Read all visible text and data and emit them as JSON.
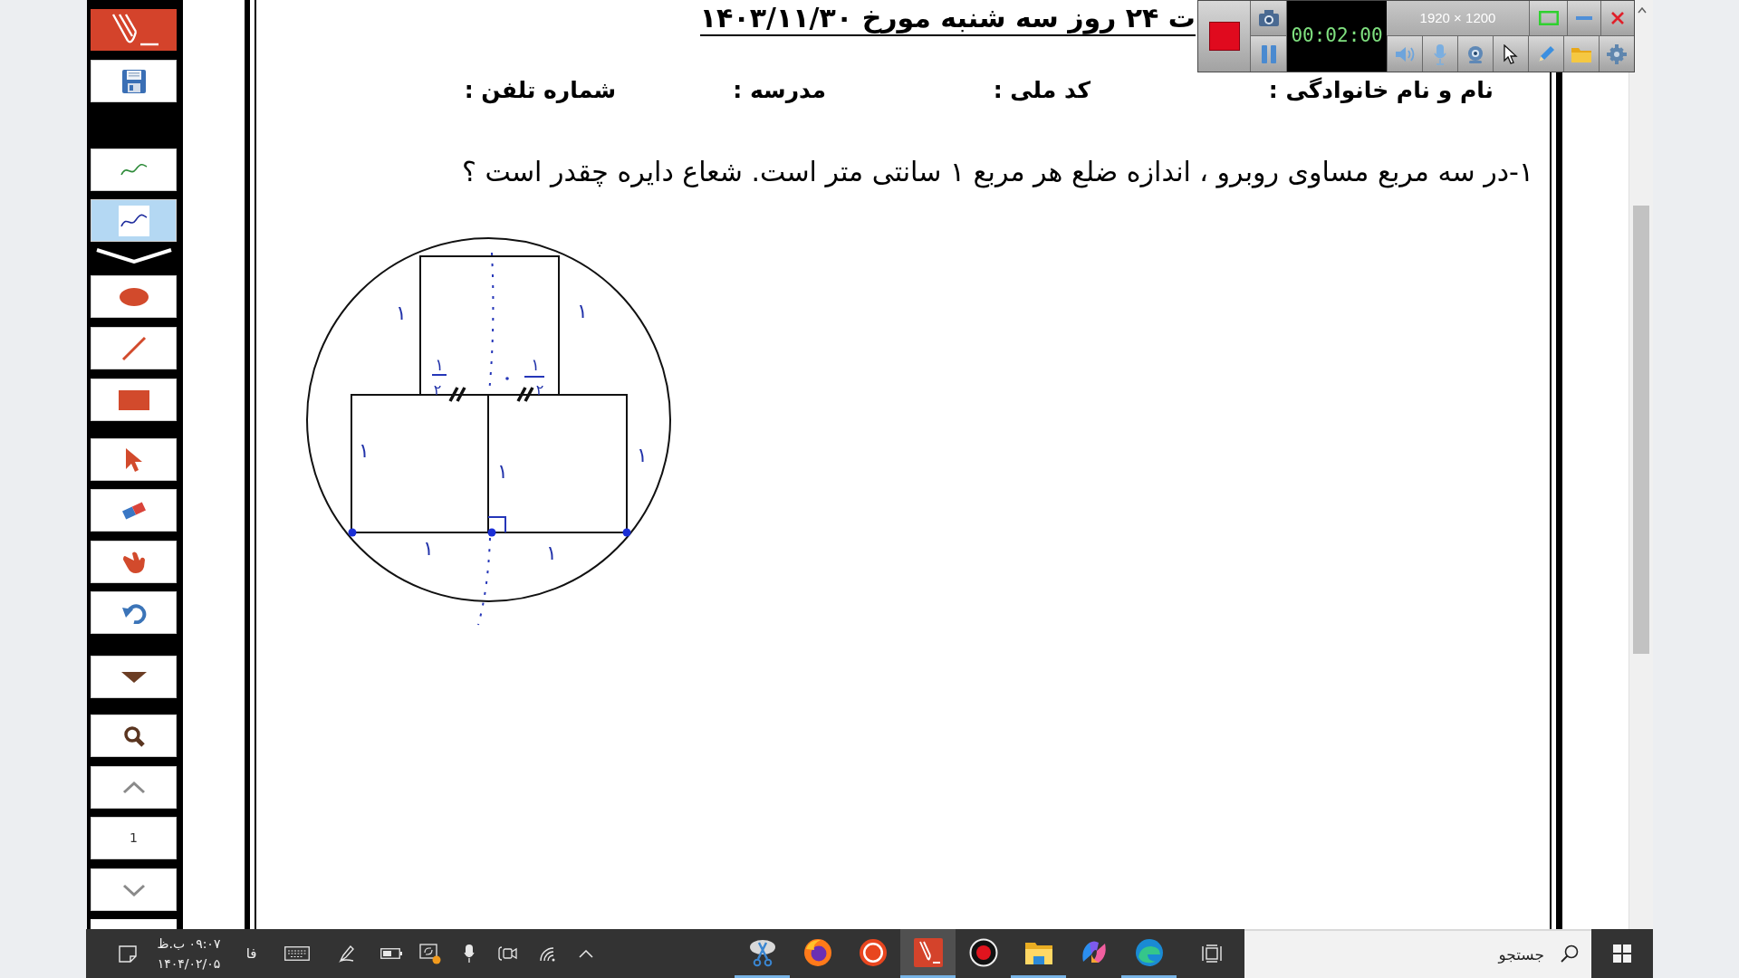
{
  "side_toolbar": {
    "tools": [
      {
        "kind": "pen",
        "color": "#2e8b3a",
        "selected": false
      },
      {
        "kind": "pen",
        "color": "#1c2a9c",
        "selected": true
      },
      {
        "kind": "ellipse",
        "selected": false
      },
      {
        "kind": "line",
        "selected": false
      },
      {
        "kind": "rectangle",
        "selected": false
      },
      {
        "kind": "pointer",
        "selected": false
      },
      {
        "kind": "eraser",
        "selected": false
      },
      {
        "kind": "hand",
        "selected": false
      }
    ],
    "page_number": "1"
  },
  "document": {
    "heading": "ت ۲۴ روز سه شنبه مورخ ۱۴۰۳/۱۱/۳۰",
    "form_labels": [
      "نام و نام خانوادگی :",
      "کد ملی :",
      "مدرسه :",
      "شماره تلفن :"
    ],
    "question": "۱-در سه مربع مساوی روبرو ، اندازه ضلع هر مربع ۱ سانتی متر است. شعاع دایره چقدر است ؟",
    "figure": {
      "side_labels": [
        "۱",
        "۱",
        "۱",
        "۱",
        "۱",
        "۱",
        "۱"
      ],
      "fractions": [
        {
          "numerator": "۱",
          "denominator": "۲"
        },
        {
          "numerator": "۱",
          "denominator": "۲"
        }
      ]
    }
  },
  "recorder": {
    "timer": "00:02:00",
    "resolution": "1920 × 1200"
  },
  "taskbar": {
    "clock": {
      "time": "۰۹:۰۷ ب.ظ",
      "date": "۱۴۰۴/۰۲/۰۵"
    },
    "language": "فا",
    "apps": [
      {
        "kind": "scissors",
        "running": true,
        "selected": false
      },
      {
        "kind": "fox-globe",
        "running": false,
        "selected": false
      },
      {
        "kind": "target",
        "running": false,
        "selected": false
      },
      {
        "kind": "pen-logo",
        "running": true,
        "selected": true
      },
      {
        "kind": "record",
        "running": false,
        "selected": false
      },
      {
        "kind": "folder",
        "running": true,
        "selected": false
      },
      {
        "kind": "swirl",
        "running": false,
        "selected": false
      },
      {
        "kind": "wave",
        "running": true,
        "selected": false
      }
    ],
    "search": {
      "placeholder": "جستجو"
    }
  }
}
